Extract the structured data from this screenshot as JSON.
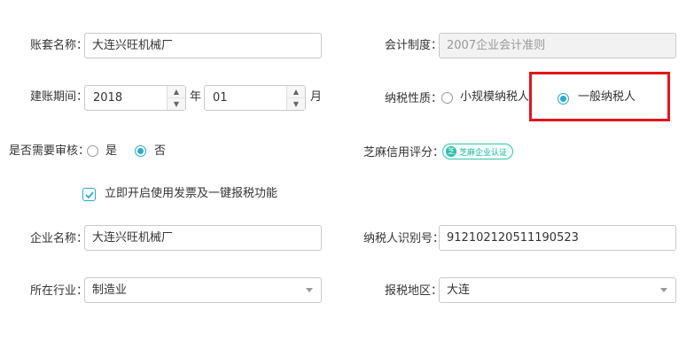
{
  "account_name": {
    "label": "账套名称：",
    "value": "大连兴旺机械厂"
  },
  "accounting_system": {
    "label": "会计制度：",
    "value": "2007企业会计准则"
  },
  "start_period": {
    "label": "建账期间：",
    "year": "2018",
    "year_unit": "年",
    "month": "01",
    "month_unit": "月"
  },
  "taxpayer_type": {
    "label": "纳税性质：",
    "options": [
      "小规模纳税人",
      "一般纳税人"
    ],
    "selected": "一般纳税人"
  },
  "requires_review": {
    "label": "是否需要审核：",
    "options": [
      "是",
      "否"
    ],
    "selected": "否"
  },
  "sesame_credit": {
    "label": "芝麻信用评分：",
    "badge_text": "芝麻企业认证"
  },
  "enable_invoice": {
    "label": "立即开启使用发票及一键报税功能",
    "checked": true
  },
  "company_name": {
    "label": "企业名称：",
    "value": "大连兴旺机械厂"
  },
  "taxpayer_id": {
    "label": "纳税人识别号：",
    "value": "912102120511190523"
  },
  "industry": {
    "label": "所在行业：",
    "value": "制造业"
  },
  "tax_region": {
    "label": "报税地区：",
    "value": "大连"
  },
  "colors": {
    "accent": "#2aa9d6",
    "highlight": "#e5141b",
    "sesame": "#2ebfa8"
  },
  "icons": [
    "spin-up-icon",
    "spin-down-icon",
    "check-icon",
    "chevron-down-icon",
    "sesame-icon"
  ]
}
